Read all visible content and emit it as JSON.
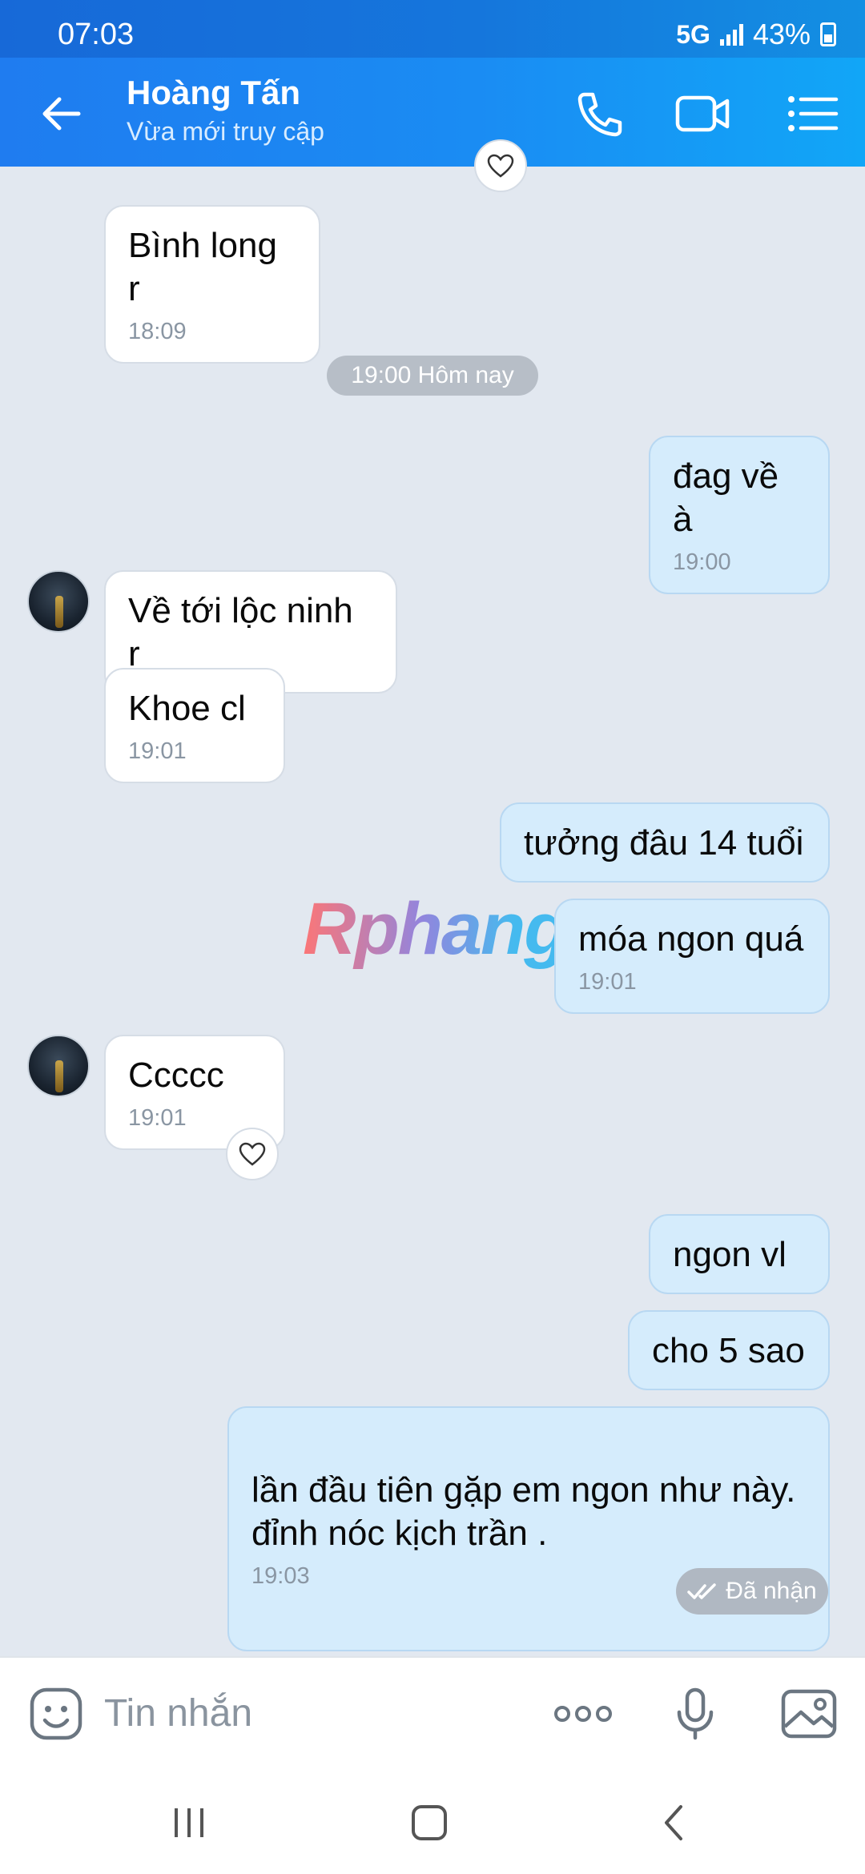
{
  "status": {
    "time": "07:03",
    "network": "5G",
    "battery": "43%"
  },
  "header": {
    "name": "Hoàng Tấn",
    "subtitle": "Vừa mới truy cập"
  },
  "chat": {
    "date_separator": "19:00 Hôm nay",
    "messages": [
      {
        "dir": "in",
        "text": "Bình long r",
        "time": "18:09"
      },
      {
        "dir": "out",
        "text": "đag về à",
        "time": "19:00"
      },
      {
        "dir": "in",
        "text": "Về tới lộc ninh r",
        "time": ""
      },
      {
        "dir": "in",
        "text": "Khoe cl",
        "time": "19:01"
      },
      {
        "dir": "out",
        "text": "tưởng đâu 14 tuổi",
        "time": ""
      },
      {
        "dir": "out",
        "text": "móa ngon quá",
        "time": "19:01"
      },
      {
        "dir": "in",
        "text": "Ccccc",
        "time": "19:01"
      },
      {
        "dir": "out",
        "text": "ngon vl",
        "time": ""
      },
      {
        "dir": "out",
        "text": "cho 5 sao",
        "time": ""
      },
      {
        "dir": "out",
        "text": "lần đầu tiên gặp em ngon như này.\nđỉnh nóc kịch trần .",
        "time": "19:03"
      }
    ],
    "delivery_status": "Đã nhận",
    "watermark": "Rphang"
  },
  "input": {
    "placeholder": "Tin nhắn"
  },
  "icons": {
    "back": "arrow-left-icon",
    "call": "phone-icon",
    "video": "video-camera-icon",
    "menu": "list-menu-icon",
    "sticker": "sticker-face-icon",
    "more": "more-dots-icon",
    "mic": "microphone-icon",
    "image": "image-icon",
    "reaction": "heart-icon"
  },
  "colors": {
    "header": "#1a8cf3",
    "bubble_out": "#d5ecfc",
    "bubble_in": "#ffffff",
    "background": "#e2e8f0"
  }
}
